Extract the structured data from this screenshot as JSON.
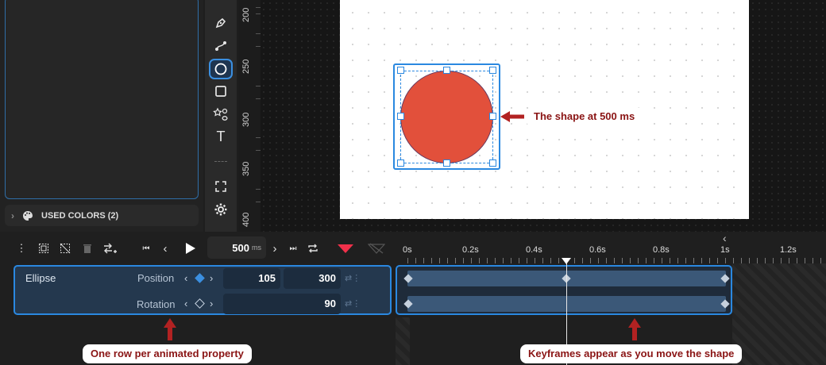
{
  "sidebar": {
    "used_colors_label": "USED COLORS (2)"
  },
  "ruler": {
    "marks": [
      "200",
      "250",
      "300",
      "350",
      "400"
    ]
  },
  "canvas": {
    "shape_fill": "#e2503b",
    "selection_color": "#2a88e0",
    "callout_shape": "The shape at 500 ms"
  },
  "timeline": {
    "current_time": "500",
    "time_unit": "ms",
    "time_labels": [
      "0s",
      "0.2s",
      "0.4s",
      "0.6s",
      "0.8s",
      "1s",
      "1.2s"
    ],
    "layer_name": "Ellipse",
    "properties": [
      {
        "label": "Position",
        "values": [
          "105",
          "300"
        ]
      },
      {
        "label": "Rotation",
        "values": [
          "90"
        ]
      }
    ],
    "callout_rows": "One row per animated property",
    "callout_keyframes": "Keyframes appear as you move the shape"
  },
  "icons": {
    "tools": [
      "pen-icon",
      "path-icon",
      "ellipse-icon",
      "rectangle-icon",
      "shapes-icon",
      "text-icon",
      "fit-icon",
      "settings-icon"
    ],
    "accent": "#2a88e0",
    "arrow_color": "#b22222"
  }
}
